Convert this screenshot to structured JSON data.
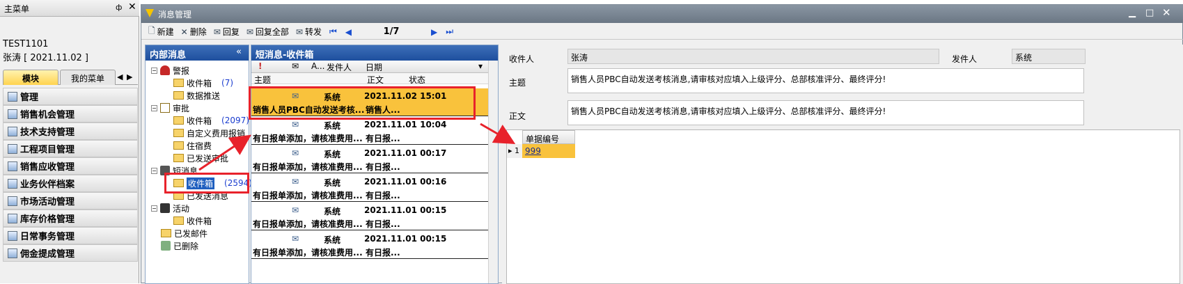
{
  "left_panel": {
    "title": "主菜单",
    "pin": "ф",
    "close": "✕",
    "user_line1": "TEST1101",
    "user_line2": "张涛 [ 2021.11.02 ]",
    "tabs": [
      "模块",
      "我的菜单"
    ],
    "tab_prev": "◀",
    "tab_next": "▶",
    "menu_items": [
      "管理",
      "销售机会管理",
      "技术支持管理",
      "工程项目管理",
      "销售应收管理",
      "业务伙伴档案",
      "市场活动管理",
      "库存价格管理",
      "日常事务管理",
      "佣金提成管理"
    ]
  },
  "window": {
    "title": "消息管理",
    "min": "▁",
    "max": "□",
    "close": "✕"
  },
  "toolbar": {
    "new": "新建",
    "delete": "删除",
    "reply": "回复",
    "reply_all": "回复全部",
    "forward": "转发",
    "first": "⏮",
    "prev": "◀",
    "page": "1/7",
    "next": "▶",
    "last": "⏭"
  },
  "tree": {
    "header": "内部消息",
    "collapse": "«",
    "nodes": {
      "alarm": "警报",
      "alarm_inbox": "收件箱",
      "alarm_inbox_count": "(7)",
      "data_push": "数据推送",
      "approval": "审批",
      "approval_inbox": "收件箱",
      "approval_inbox_count": "(2097)",
      "custom_expense": "自定义费用报销",
      "lodging": "住宿费",
      "sent_approval": "已发送审批",
      "sms": "短消息",
      "sms_inbox": "收件箱",
      "sms_inbox_count": "(2594)",
      "sent_msg": "已发送消息",
      "activity": "活动",
      "activity_inbox": "收件箱",
      "sent_mail": "已发邮件",
      "deleted": "已删除"
    }
  },
  "list": {
    "header": "短消息-收件箱",
    "columns": {
      "flag": "!",
      "read": "✉",
      "attach": "A...",
      "sender": "发件人",
      "date": "日期",
      "dropdown": "▾",
      "subject": "主题",
      "body": "正文",
      "status": "状态"
    },
    "messages": [
      {
        "sender": "系统",
        "date": "2021.11.02 15:01",
        "subject": "销售人员PBC自动发送考核...",
        "status": "销售人..."
      },
      {
        "sender": "系统",
        "date": "2021.11.01 10:04",
        "subject": "有日报单添加，请核准费用...",
        "status": "有日报..."
      },
      {
        "sender": "系统",
        "date": "2021.11.01 00:17",
        "subject": "有日报单添加，请核准费用...",
        "status": "有日报..."
      },
      {
        "sender": "系统",
        "date": "2021.11.01 00:16",
        "subject": "有日报单添加，请核准费用...",
        "status": "有日报..."
      },
      {
        "sender": "系统",
        "date": "2021.11.01 00:15",
        "subject": "有日报单添加，请核准费用...",
        "status": "有日报..."
      },
      {
        "sender": "系统",
        "date": "2021.11.01 00:15",
        "subject": "有日报单添加，请核准费用...",
        "status": "有日报..."
      }
    ]
  },
  "detail": {
    "recipient_label": "收件人",
    "recipient": "张涛",
    "sender_label": "发件人",
    "sender": "系统",
    "subject_label": "主题",
    "subject": "销售人员PBC自动发送考核消息,请审核对应填入上级评分、总部核准评分、最终评分!",
    "body_label": "正文",
    "body": "销售人员PBC自动发送考核消息,请审核对应填入上级评分、总部核准评分、最终评分!",
    "grid_header": "单据编号",
    "grid_row": "▸ 1",
    "grid_value": "999"
  }
}
